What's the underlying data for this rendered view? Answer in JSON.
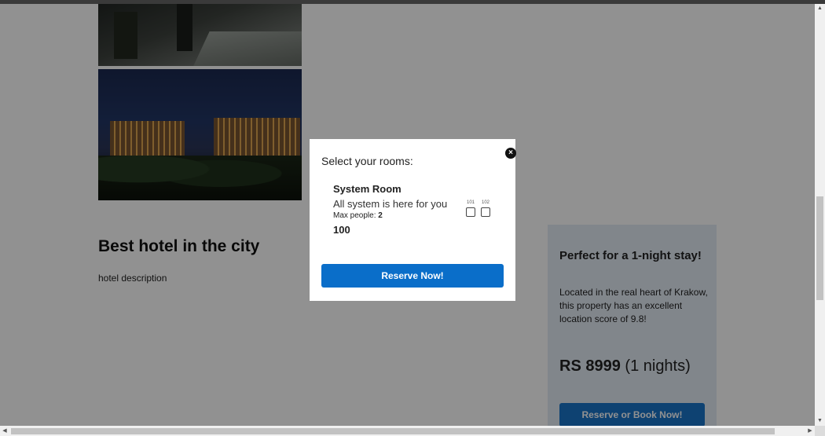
{
  "hotel": {
    "title": "Best hotel in the city",
    "description": "hotel description"
  },
  "side_card": {
    "title": "Perfect for a 1-night stay!",
    "text": "Located in the real heart of Krakow, this property has an excellent location score of 9.8!",
    "price": "RS 8999",
    "nights": "(1 nights)",
    "button": "Reserve or Book Now!"
  },
  "modal": {
    "heading": "Select your rooms:",
    "close_label": "×",
    "room": {
      "name": "System Room",
      "description": "All system is here for you",
      "max_people_label": "Max people:",
      "max_people": "2",
      "price": "100",
      "numbers": [
        "101",
        "102"
      ]
    },
    "reserve_button": "Reserve Now!"
  },
  "scrollbars": {
    "up": "▲",
    "down": "▼",
    "left": "◀",
    "right": "▶"
  },
  "colors": {
    "primary_button": "#0a6ec9",
    "card_background": "#e3ebf5",
    "overlay": "rgba(0,0,0,0.43)"
  }
}
